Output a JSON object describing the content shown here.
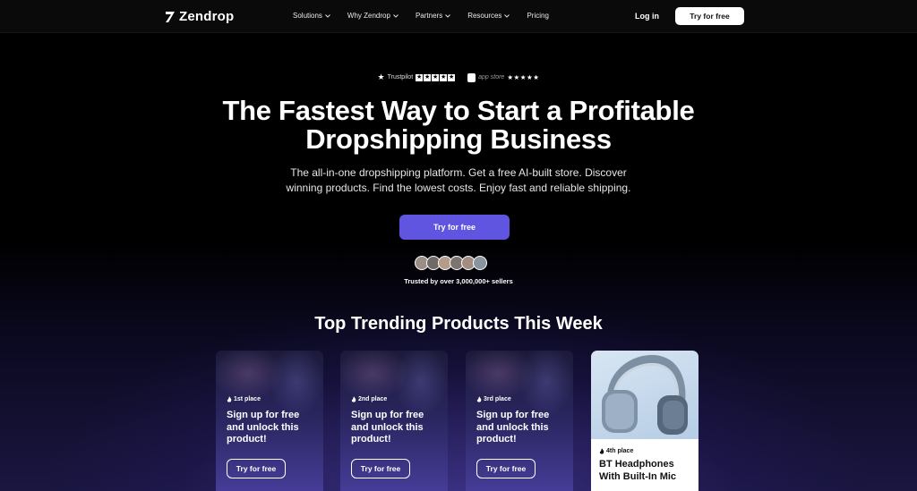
{
  "header": {
    "logo_text": "Zendrop",
    "menu": [
      {
        "label": "Solutions",
        "dropdown": true
      },
      {
        "label": "Why Zendrop",
        "dropdown": true
      },
      {
        "label": "Partners",
        "dropdown": true
      },
      {
        "label": "Resources",
        "dropdown": true
      },
      {
        "label": "Pricing",
        "dropdown": false
      }
    ],
    "login_label": "Log in",
    "cta_label": "Try for free"
  },
  "ratings": {
    "trustpilot_label": "Trustpilot",
    "appstore_label": "app store"
  },
  "hero": {
    "title_line1": "The Fastest Way to Start a Profitable",
    "title_line2": "Dropshipping Business",
    "subtitle_line1": "The all-in-one dropshipping platform. Get a free AI-built store. Discover",
    "subtitle_line2": "winning products. Find the lowest costs. Enjoy fast and reliable shipping.",
    "cta_label": "Try for free",
    "trusted_text": "Trusted by over 3,000,000+ sellers"
  },
  "trending": {
    "title": "Top Trending Products This Week",
    "cards": [
      {
        "place": "1st place",
        "text": "Sign up for free and unlock this product!",
        "button": "Try for free"
      },
      {
        "place": "2nd place",
        "text": "Sign up for free and unlock this product!",
        "button": "Try for free"
      },
      {
        "place": "3rd place",
        "text": "Sign up for free and unlock this product!",
        "button": "Try for free"
      }
    ],
    "featured": {
      "place": "4th place",
      "name": "BT Headphones With Built-In Mic"
    }
  },
  "colors": {
    "accent": "#5f55e0",
    "background": "#000000",
    "card_gradient_end": "#4a40a0"
  }
}
